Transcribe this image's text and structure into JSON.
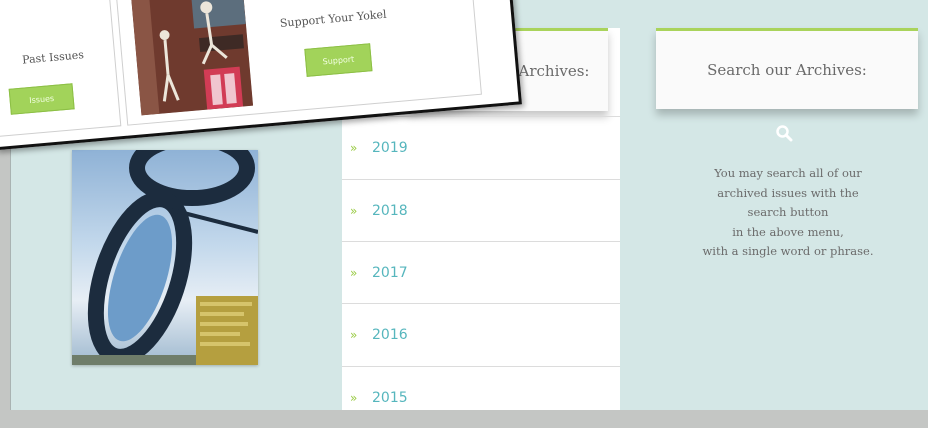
{
  "popup": {
    "past_issues_label": "Past Issues",
    "past_issues_button": "Issues",
    "support_title": "Support Your Yokel",
    "support_button": "Support"
  },
  "archives": {
    "header": "Browse our Archives:",
    "years": [
      "2019",
      "2018",
      "2017",
      "2016",
      "2015"
    ]
  },
  "search": {
    "header": "Search our Archives:",
    "description_lines": [
      "You may search all of our",
      "archived issues with the",
      "search button",
      "in the above menu,",
      "with a single word or phrase."
    ]
  },
  "colors": {
    "accent_green": "#a2d35a",
    "link_teal": "#56b6bd",
    "page_bg": "#d4e7e6"
  }
}
